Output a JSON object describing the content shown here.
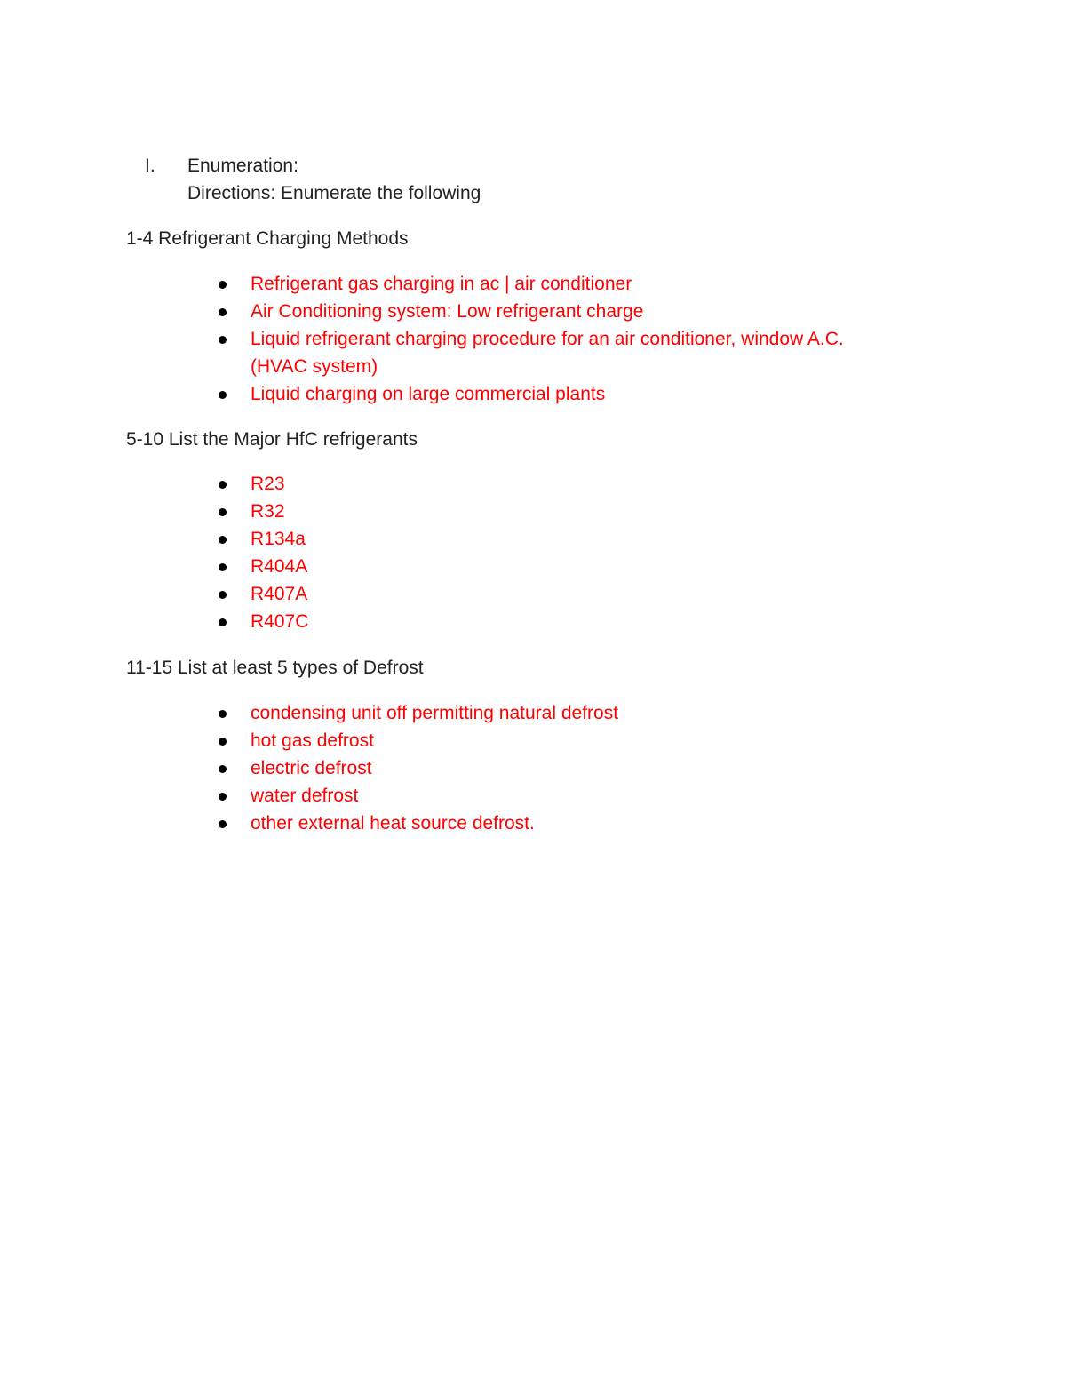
{
  "header": {
    "numeral": "I.",
    "title": "Enumeration:",
    "directions": "Directions:  Enumerate the following"
  },
  "sections": [
    {
      "title": "1-4 Refrigerant Charging Methods",
      "items": [
        "Refrigerant gas charging in ac | air conditioner",
        "Air Conditioning system: Low refrigerant charge",
        "Liquid refrigerant charging procedure for an air conditioner, window A.C.",
        "(HVAC system)",
        "Liquid charging on large commercial plants"
      ]
    },
    {
      "title": "5-10 List the Major HfC refrigerants",
      "items": [
        "R23",
        "R32",
        "R134a",
        "R404A",
        "R407A",
        "R407C"
      ]
    },
    {
      "title": "11-15 List at least 5 types of Defrost",
      "items": [
        "condensing unit off permitting natural defrost",
        "hot gas defrost",
        "electric defrost",
        "water defrost",
        "other external heat source defrost."
      ]
    }
  ],
  "colors": {
    "answer_text": "#ff0000",
    "body_text": "#222222",
    "bullet": "#000000"
  }
}
